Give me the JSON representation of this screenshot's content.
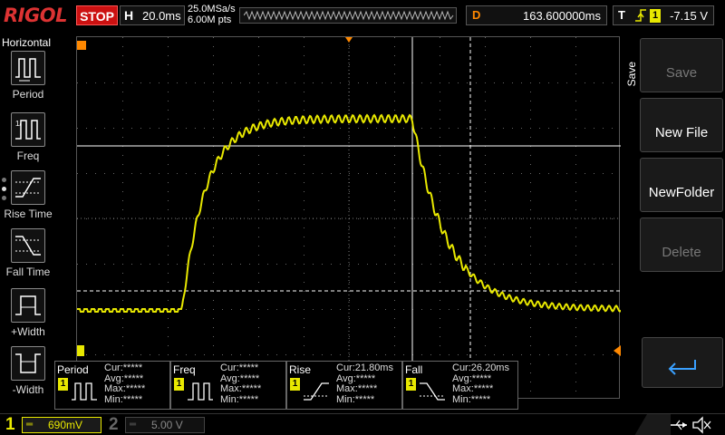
{
  "topbar": {
    "logo": "RIGOL",
    "status": "STOP",
    "horizontal_letter": "H",
    "timebase": "20.0ms",
    "sample_rate": "25.0MSa/s",
    "memory_depth": "6.00M pts",
    "delay_letter": "D",
    "delay": "163.600000ms",
    "trigger_letter": "T",
    "trigger_source": "1",
    "trigger_level": "-7.15 V"
  },
  "left_menu": {
    "title": "Horizontal",
    "items": [
      {
        "label": "Period",
        "icon": "period-icon"
      },
      {
        "label": "Freq",
        "icon": "frequency-icon"
      },
      {
        "label": "Rise Time",
        "icon": "rise-time-icon"
      },
      {
        "label": "Fall Time",
        "icon": "fall-time-icon"
      },
      {
        "label": "+Width",
        "icon": "positive-width-icon"
      },
      {
        "label": "-Width",
        "icon": "negative-width-icon"
      }
    ]
  },
  "save_menu": {
    "title": "Save",
    "buttons": [
      {
        "label": "Save",
        "enabled": false
      },
      {
        "label": "New File",
        "enabled": true
      },
      {
        "label": "NewFolder",
        "enabled": true
      },
      {
        "label": "Delete",
        "enabled": false
      }
    ],
    "return_icon": "return-arrow-icon"
  },
  "measurements": [
    {
      "name": "Period",
      "channel": "1",
      "cur": "Cur:*****",
      "avg": "Avg:*****",
      "max": "Max:*****",
      "min": "Min:*****",
      "icon": "period-icon"
    },
    {
      "name": "Freq",
      "channel": "1",
      "cur": "Cur:*****",
      "avg": "Avg:*****",
      "max": "Max:*****",
      "min": "Min:*****",
      "icon": "frequency-icon"
    },
    {
      "name": "Rise",
      "channel": "1",
      "cur": "Cur:21.80ms",
      "avg": "Avg:*****",
      "max": "Max:*****",
      "min": "Min:*****",
      "icon": "rise-time-icon"
    },
    {
      "name": "Fall",
      "channel": "1",
      "cur": "Cur:26.20ms",
      "avg": "Avg:*****",
      "max": "Max:*****",
      "min": "Min:*****",
      "icon": "fall-time-icon"
    }
  ],
  "channels": [
    {
      "number": "1",
      "scale": "690mV",
      "active": true
    },
    {
      "number": "2",
      "scale": "5.00 V",
      "active": false
    }
  ],
  "colors": {
    "ch1": "#e8e800",
    "trigger_marker": "#ff8800",
    "stop": "#cc1111"
  }
}
